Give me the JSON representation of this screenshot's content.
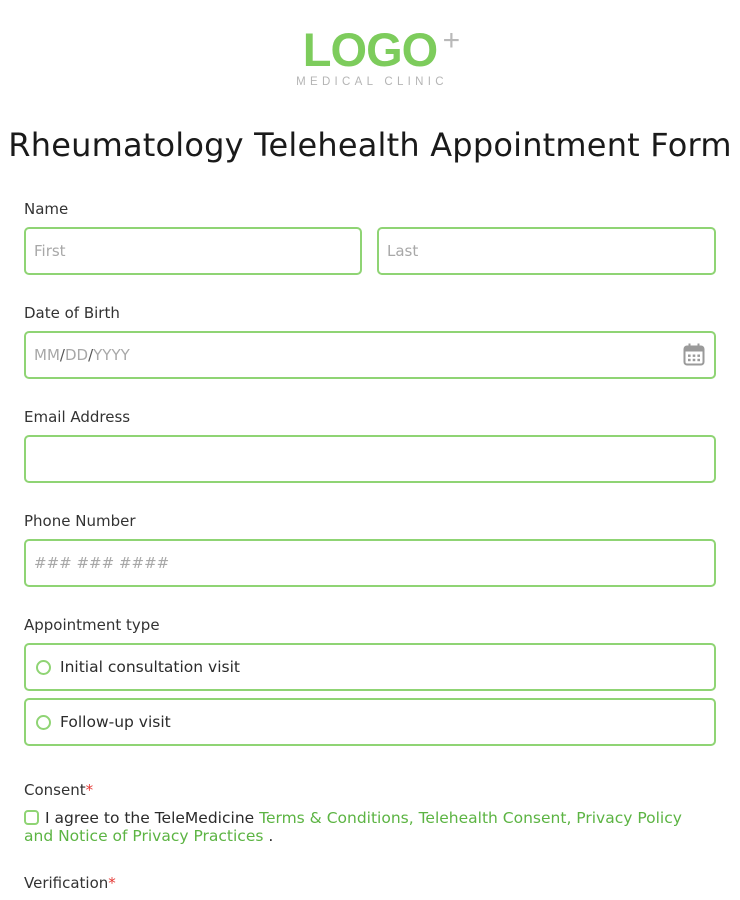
{
  "logo": {
    "word": "LOGO",
    "plus": "+",
    "subtitle": "MEDICAL CLINIC"
  },
  "title": "Rheumatology Telehealth Appointment Form",
  "name": {
    "label": "Name",
    "first_placeholder": "First",
    "last_placeholder": "Last"
  },
  "dob": {
    "label": "Date of Birth",
    "mm": "MM",
    "dd": "DD",
    "yyyy": "YYYY",
    "sep": "/",
    "icon": "calendar-icon"
  },
  "email": {
    "label": "Email Address",
    "value": ""
  },
  "phone": {
    "label": "Phone Number",
    "placeholder": "### ### ####"
  },
  "appointment": {
    "label": "Appointment type",
    "options": [
      {
        "label": "Initial consultation visit"
      },
      {
        "label": "Follow-up visit"
      }
    ]
  },
  "consent": {
    "label": "Consent",
    "required_mark": "*",
    "text_before": "I agree to the TeleMedicine ",
    "link_text": "Terms & Conditions, Telehealth Consent, Privacy Policy and Notice of Privacy Practices",
    "text_after": " ."
  },
  "verification": {
    "label": "Verification",
    "required_mark": "*"
  },
  "colors": {
    "accent": "#8fd474",
    "logo": "#7dcc5c",
    "link": "#5cb443",
    "required": "#e53935"
  }
}
